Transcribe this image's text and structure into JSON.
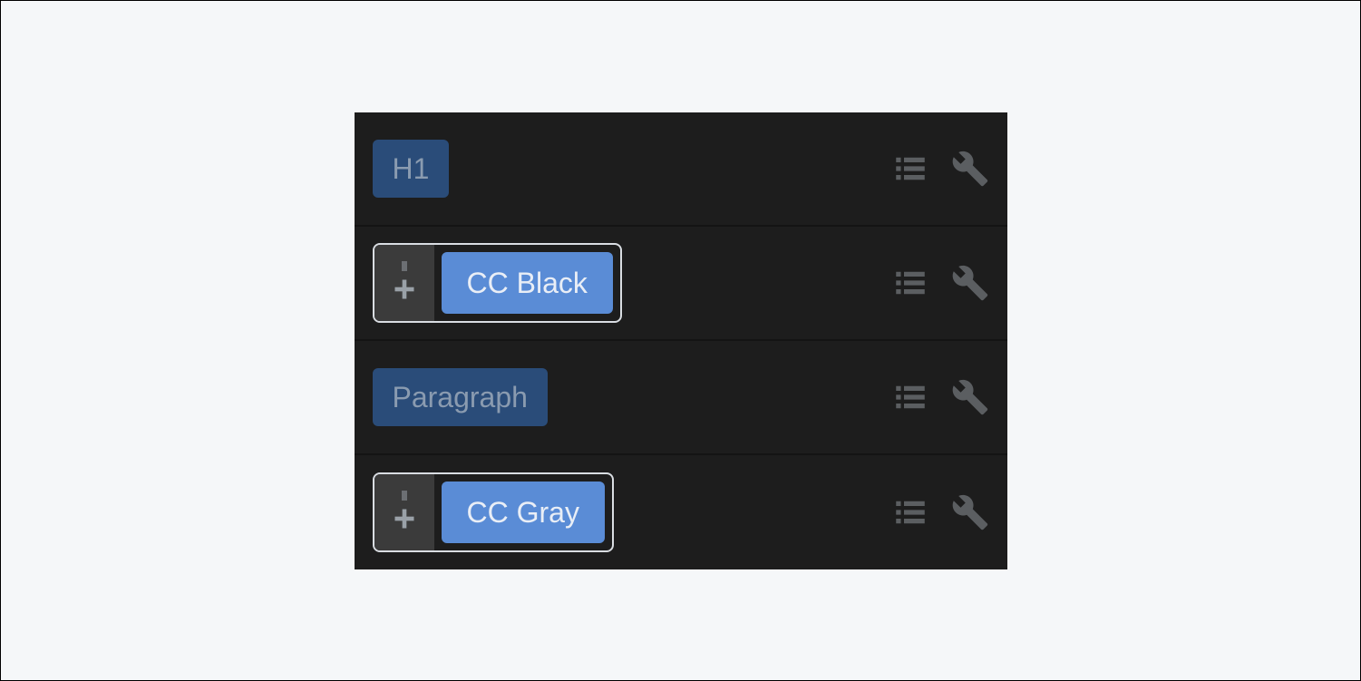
{
  "rows": [
    {
      "type": "tag",
      "label": "H1"
    },
    {
      "type": "pill",
      "label": "CC Black"
    },
    {
      "type": "tag",
      "label": "Paragraph"
    },
    {
      "type": "pill",
      "label": "CC Gray"
    }
  ],
  "icons": {
    "list": "list-icon",
    "wrench": "wrench-icon",
    "plus": "plus-icon",
    "drag": "drag-handle"
  }
}
